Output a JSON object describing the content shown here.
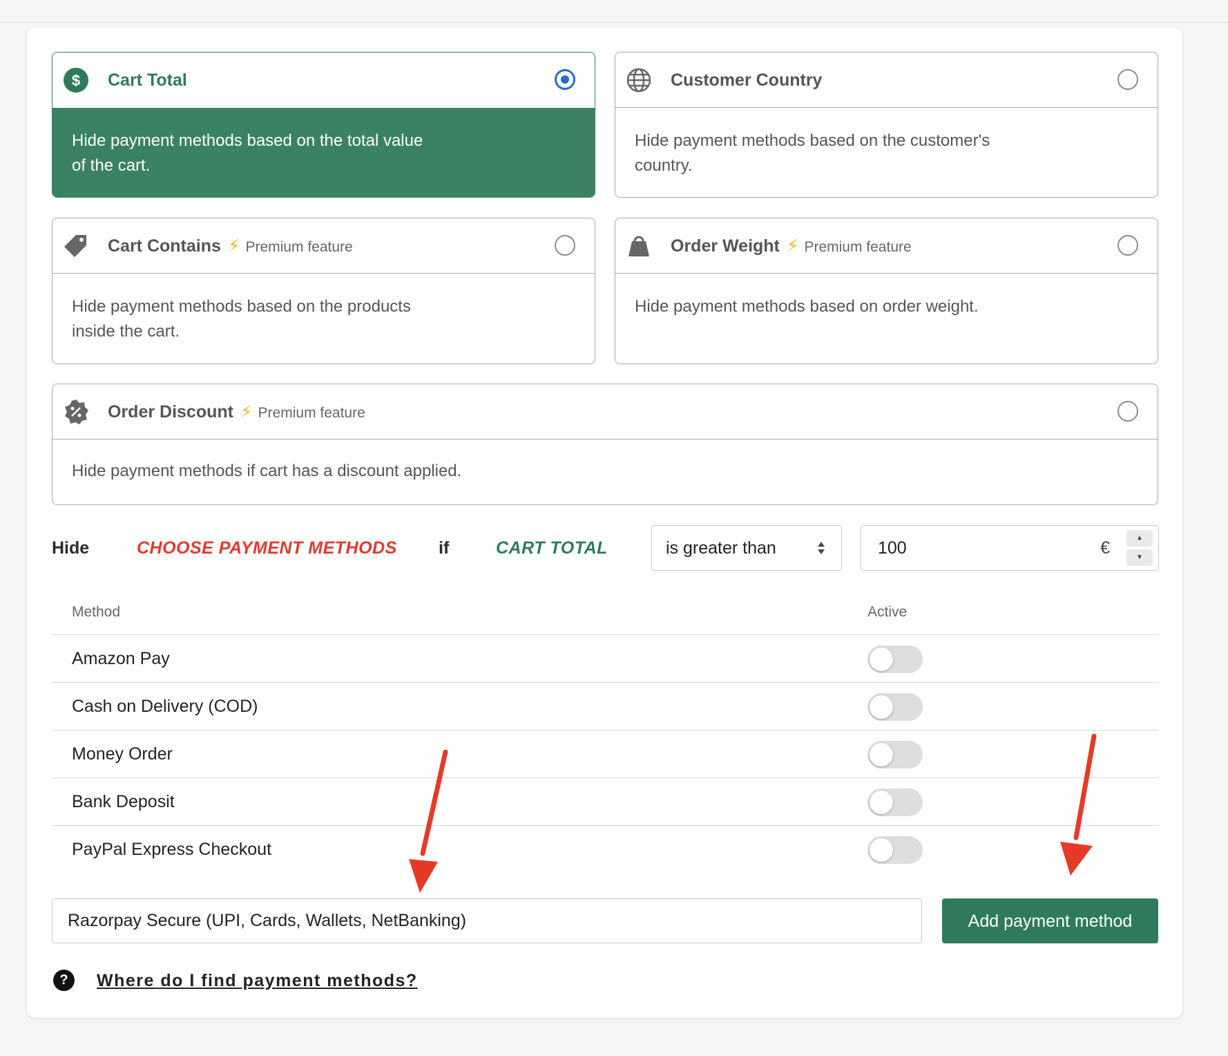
{
  "rule_types": [
    {
      "id": "cart-total",
      "title": "Cart Total",
      "premium": "",
      "description": "Hide payment methods based on the total value of the cart.",
      "selected": true
    },
    {
      "id": "customer-country",
      "title": "Customer Country",
      "premium": "",
      "description": "Hide payment methods based on the customer's country.",
      "selected": false
    },
    {
      "id": "cart-contains",
      "title": "Cart Contains",
      "premium": "Premium feature",
      "description": "Hide payment methods based on the products inside the cart.",
      "selected": false
    },
    {
      "id": "order-weight",
      "title": "Order Weight",
      "premium": "Premium feature",
      "description": "Hide payment methods based on order weight.",
      "selected": false
    },
    {
      "id": "order-discount",
      "title": "Order Discount",
      "premium": "Premium feature",
      "description": "Hide payment methods if cart has a discount applied.",
      "selected": false
    }
  ],
  "condition": {
    "hide": "Hide",
    "methods_placeholder": "CHOOSE PAYMENT METHODS",
    "if": "if",
    "field": "CART TOTAL",
    "operator": "is greater than",
    "value": "100",
    "currency": "€"
  },
  "table": {
    "col_method": "Method",
    "col_active": "Active",
    "rows": [
      {
        "name": "Amazon Pay",
        "active": false
      },
      {
        "name": "Cash on Delivery (COD)",
        "active": false
      },
      {
        "name": "Money Order",
        "active": false
      },
      {
        "name": "Bank Deposit",
        "active": false
      },
      {
        "name": "PayPal Express Checkout",
        "active": false
      }
    ]
  },
  "add_method": {
    "input_value": "Razorpay Secure (UPI, Cards, Wallets, NetBanking)",
    "button_label": "Add payment method"
  },
  "help": {
    "link_text": "Where do I find payment methods?"
  },
  "icons": {
    "cart_total": "dollar-icon",
    "customer_country": "globe-icon",
    "cart_contains": "tag-icon",
    "order_weight": "weight-icon",
    "order_discount": "discount-badge-icon",
    "premium": "lightning-icon",
    "help": "question-circle-icon"
  },
  "colors": {
    "accent_green": "#3a8262",
    "radio_blue": "#2a6ac9",
    "warning_red": "#e03a2e",
    "bolt": "#f0b52a"
  }
}
